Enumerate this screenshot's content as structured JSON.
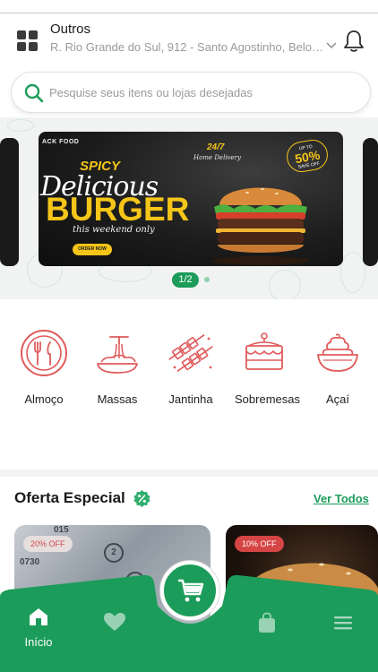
{
  "header": {
    "address_label": "Outros",
    "address_line": "R. Rio Grande do Sul, 912 - Santo Agostinho, Belo H..."
  },
  "search": {
    "placeholder": "Pesquise seus itens ou lojas desejadas"
  },
  "banner": {
    "brand": "ACK FOOD",
    "spicy": "SPICY",
    "delicious": "Delicious",
    "burger": "BURGER",
    "weekend": "this weekend only",
    "order_button": "ORDER NOW",
    "home_247": "24/7",
    "home_delivery": "Home Delivery",
    "save_up_to": "UP TO",
    "save_pct": "50%",
    "save_off": "SAVE OFF",
    "pager": "1/2"
  },
  "categories": [
    {
      "label": "Almoço",
      "icon": "plate-cutlery-icon"
    },
    {
      "label": "Massas",
      "icon": "pasta-icon"
    },
    {
      "label": "Jantinha",
      "icon": "skewers-icon"
    },
    {
      "label": "Sobremesas",
      "icon": "cake-icon"
    },
    {
      "label": "Açaí",
      "icon": "acai-bowl-icon"
    }
  ],
  "offers": {
    "title": "Oferta Especial",
    "see_all": "Ver Todos",
    "cards": [
      {
        "discount": "20% OFF"
      },
      {
        "discount": "10% OFF"
      }
    ]
  },
  "nav": {
    "home_label": "Início"
  },
  "colors": {
    "brand_green": "#1c9c5a",
    "category_red": "#e05a5a",
    "banner_yellow": "#f5c518"
  }
}
